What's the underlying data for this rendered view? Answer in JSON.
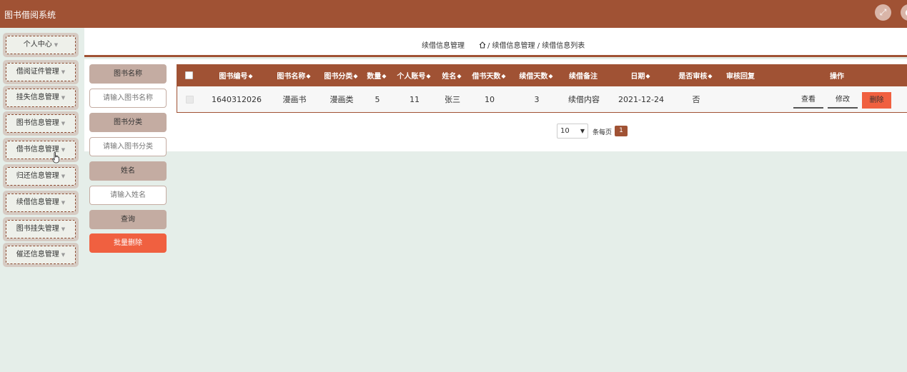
{
  "app": {
    "title": "图书借阅系统"
  },
  "header": {
    "expand_icon": "expand-icon",
    "user_icon": "user-icon"
  },
  "sidebar": {
    "items": [
      {
        "label": "个人中心"
      },
      {
        "label": "借阅证件管理"
      },
      {
        "label": "挂失信息管理"
      },
      {
        "label": "图书信息管理"
      },
      {
        "label": "借书信息管理"
      },
      {
        "label": "归还信息管理"
      },
      {
        "label": "续借信息管理"
      },
      {
        "label": "图书挂失管理"
      },
      {
        "label": "催还信息管理"
      }
    ]
  },
  "breadcrumb": {
    "title": "续借信息管理",
    "path": "/ 续借信息管理 / 续借信息列表"
  },
  "search": {
    "book_name_label": "图书名称",
    "book_name_placeholder": "请输入图书名称",
    "category_label": "图书分类",
    "category_placeholder": "请输入图书分类",
    "name_label": "姓名",
    "name_placeholder": "请输入姓名",
    "query_label": "查询",
    "batch_delete_label": "批量删除"
  },
  "table": {
    "columns": [
      "图书编号",
      "图书名称",
      "图书分类",
      "数量",
      "个人账号",
      "姓名",
      "借书天数",
      "续借天数",
      "续借备注",
      "日期",
      "是否审核",
      "审核回复",
      "操作"
    ],
    "sort_glyph": "◆",
    "rows": [
      {
        "book_no": "1640312026",
        "book_name": "漫画书",
        "category": "漫画类",
        "quantity": "5",
        "account": "11",
        "name": "张三",
        "borrow_days": "10",
        "renew_days": "3",
        "renew_note": "续借内容",
        "date": "2021-12-24",
        "reviewed": "否",
        "review_reply": "",
        "actions": {
          "view": "查看",
          "edit": "修改",
          "delete": "删除"
        }
      }
    ]
  },
  "pagination": {
    "page_size": "10",
    "per_page_text": "条每页",
    "current_page": "1"
  },
  "colors": {
    "brand": "#a05234",
    "accent_danger": "#f06040",
    "background": "#e5eee9"
  }
}
